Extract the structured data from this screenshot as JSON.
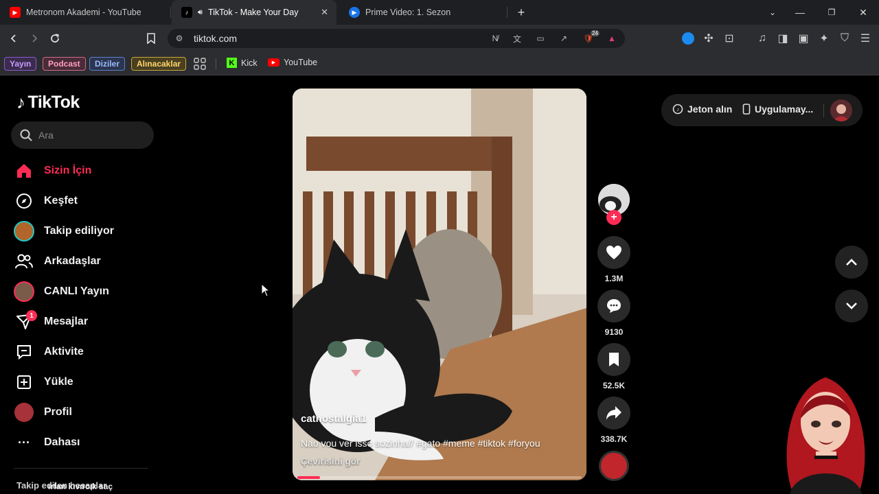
{
  "browser": {
    "tabs": [
      {
        "title": "Metronom Akademi - YouTube",
        "active": false
      },
      {
        "title": "TikTok - Make Your Day",
        "active": true
      },
      {
        "title": "Prime Video: 1. Sezon",
        "active": false
      }
    ],
    "url": "tiktok.com",
    "shield_count": "24",
    "bookmarks": {
      "pills": [
        "Yayın",
        "Podcast",
        "Diziler",
        "Alınacaklar"
      ],
      "links": [
        "Kick",
        "YouTube"
      ]
    }
  },
  "sidebar": {
    "logo": "TikTok",
    "search_placeholder": "Ara",
    "nav": [
      {
        "label": "Sizin İçin",
        "icon": "home-icon",
        "active": true
      },
      {
        "label": "Keşfet",
        "icon": "compass-icon"
      },
      {
        "label": "Takip ediliyor",
        "icon": "following-avatar-icon"
      },
      {
        "label": "Arkadaşlar",
        "icon": "friends-icon"
      },
      {
        "label": "CANLI Yayın",
        "icon": "live-avatar-icon"
      },
      {
        "label": "Mesajlar",
        "icon": "messages-icon",
        "badge": "1"
      },
      {
        "label": "Aktivite",
        "icon": "activity-icon"
      },
      {
        "label": "Yükle",
        "icon": "upload-icon"
      },
      {
        "label": "Profil",
        "icon": "profile-avatar-icon"
      },
      {
        "label": "Dahası",
        "icon": "more-icon"
      }
    ],
    "following_title": "Takip edilen hesaplar",
    "overlay_text": "ırfan kıvırcık saç"
  },
  "video": {
    "username": "catnostalgia1",
    "caption": "Nao vou ver isso sozinha// #gato #meme #tiktok #foryou",
    "translate": "Çevirisini gör",
    "progress": 0.08
  },
  "actions": {
    "likes": "1.3M",
    "comments": "9130",
    "saves": "52.5K",
    "shares": "338.7K"
  },
  "topright": {
    "coins": "Jeton alın",
    "app": "Uygulamay..."
  },
  "colors": {
    "accent": "#fe2c55",
    "background": "#000000"
  }
}
